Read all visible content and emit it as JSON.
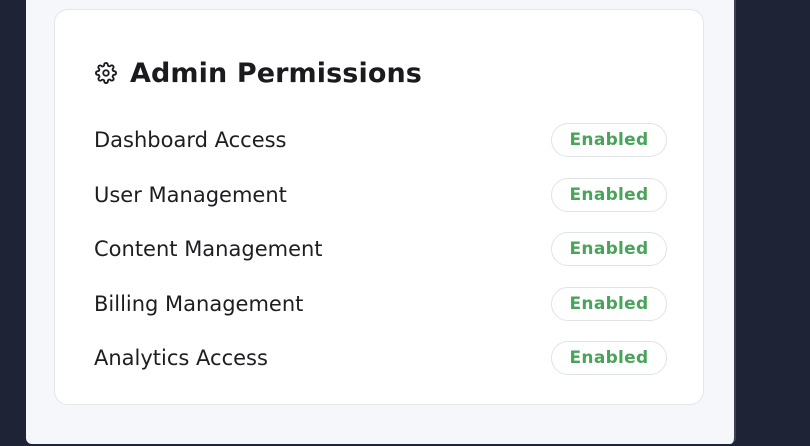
{
  "card": {
    "title": "Admin Permissions",
    "icon": "gear-icon"
  },
  "permissions": [
    {
      "label": "Dashboard Access",
      "status": "Enabled"
    },
    {
      "label": "User Management",
      "status": "Enabled"
    },
    {
      "label": "Content Management",
      "status": "Enabled"
    },
    {
      "label": "Billing Management",
      "status": "Enabled"
    },
    {
      "label": "Analytics Access",
      "status": "Enabled"
    }
  ],
  "colors": {
    "background": "#1e2436",
    "panel": "#f5f7fa",
    "card": "#ffffff",
    "status_enabled": "#4aa35a"
  }
}
